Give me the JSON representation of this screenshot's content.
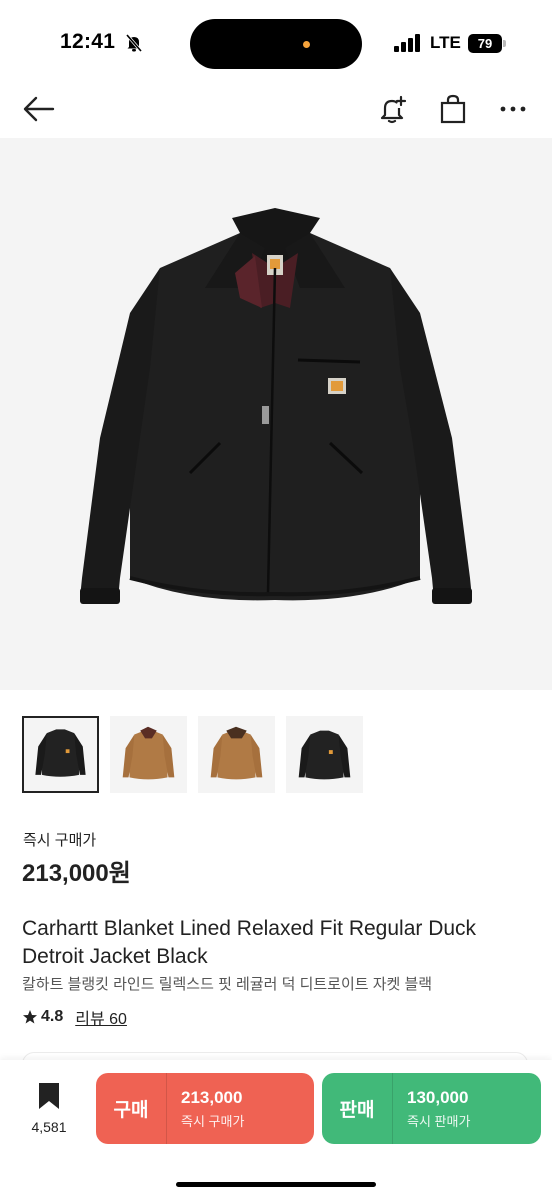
{
  "status": {
    "time": "12:41",
    "network": "LTE",
    "battery": "79"
  },
  "nav": {
    "back_icon": "arrow-left-icon",
    "alert_icon": "bell-plus-icon",
    "bag_icon": "shopping-bag-icon",
    "more_icon": "more-horizontal-icon"
  },
  "product": {
    "price_label": "즉시 구매가",
    "price": "213,000원",
    "title_en": "Carhartt Blanket Lined Relaxed Fit Regular Duck Detroit Jacket Black",
    "title_ko": "칼하트 블랭킷 라인드 릴렉스드 핏 레귤러 덕 디트로이트 자켓 블랙",
    "rating": "4.8",
    "review_label": "리뷰 60",
    "thumbnails": [
      {
        "color": "#222222",
        "collar": "#1a1a1a"
      },
      {
        "color": "#b07a45",
        "collar": "#5a2d24"
      },
      {
        "color": "#b07a45",
        "collar": "#4a3020"
      },
      {
        "color": "#222222",
        "collar": "#1a1a1a"
      }
    ]
  },
  "bottom": {
    "wish_count": "4,581",
    "buy": {
      "type": "구매",
      "price": "213,000",
      "sub": "즉시 구매가"
    },
    "sell": {
      "type": "판매",
      "price": "130,000",
      "sub": "즉시 판매가"
    }
  },
  "colors": {
    "buy": "#ef6253",
    "sell": "#41b979",
    "jacket": "#1f1f1f"
  }
}
